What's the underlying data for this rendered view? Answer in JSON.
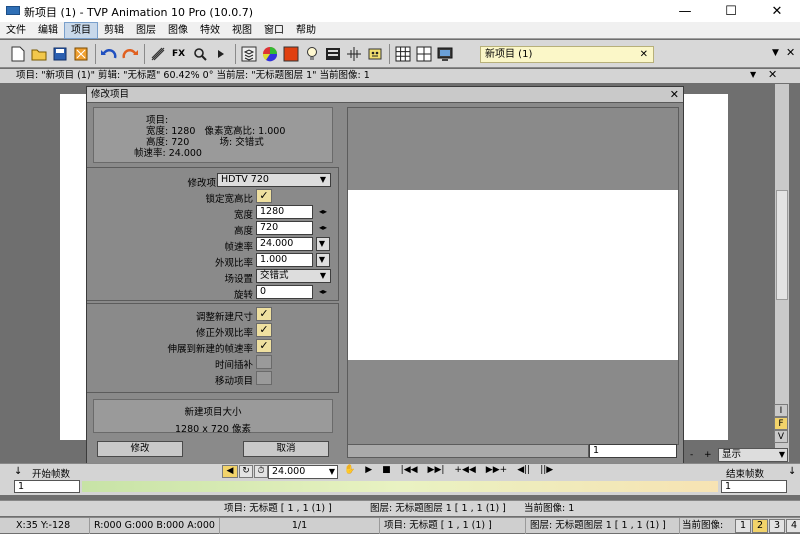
{
  "window": {
    "title": "新项目 (1) - TVP Animation 10 Pro (10.0.7)",
    "minimize": "—",
    "maximize": "☐",
    "close": "✕"
  },
  "menu": [
    "文件",
    "编辑",
    "项目",
    "剪辑",
    "图层",
    "图像",
    "特效",
    "视图",
    "窗口",
    "帮助"
  ],
  "menu_active": "项目",
  "toolbar": {
    "icons": [
      "new-file-icon",
      "open-folder-icon",
      "save-icon",
      "export-icon",
      "undo-icon",
      "redo-icon",
      "brush-tools-icon",
      "fx-icon",
      "zoom-icon",
      "play-icon",
      "layers-icon",
      "color-wheel-icon",
      "color-swatch-icon",
      "light-bulb-icon",
      "display-icon",
      "crosshair-icon",
      "robot-icon",
      "grid-icon",
      "panels-icon",
      "monitor-icon"
    ],
    "fx_label": "FX",
    "project_tab": "新项目 (1)",
    "project_tab_close": "✕"
  },
  "infobar": "项目: \"新项目 (1)\" 剪辑: \"无标题\" 60.42% 0° 当前层: \"无标题图层 1\" 当前图像: 1",
  "dialog": {
    "title": "修改项目",
    "close": "✕",
    "info": {
      "project_label": "项目:",
      "width_line": "宽度: 1280   像素宽高比: 1.000",
      "height_line": "高度: 720          场: 交错式",
      "fps_line": "帧速率: 24.000"
    },
    "modify_to_label": "修改项目到",
    "modify_to_value": "HDTV 720",
    "lock_ratio_label": "锁定宽高比",
    "width_label": "宽度",
    "width_value": "1280",
    "height_label": "高度",
    "height_value": "720",
    "fps_label": "帧速率",
    "fps_value": "24.000",
    "aspect_label": "外观比率",
    "aspect_value": "1.000",
    "field_label": "场设置",
    "field_value": "交错式",
    "rotate_label": "旋转",
    "rotate_value": "0",
    "options": [
      {
        "label": "调整新建尺寸",
        "checked": true
      },
      {
        "label": "修正外观比率",
        "checked": true
      },
      {
        "label": "伸展到新建的帧速率",
        "checked": true
      },
      {
        "label": "时间插补",
        "checked": false
      },
      {
        "label": "移动项目",
        "checked": false
      }
    ],
    "newsize_title": "新建项目大小",
    "newsize_value": "1280 x 720 像素",
    "modify_button": "修改",
    "cancel_button": "取消",
    "preview_field": "1"
  },
  "side_buttons": [
    "I",
    "F",
    "V"
  ],
  "display_label": "显示",
  "timeline": {
    "start_label": "开始帧数",
    "fps_value": "24.000",
    "end_label": "结束帧数",
    "start_value": "1",
    "end_value": "1"
  },
  "status1": {
    "project": "项目: 无标题 [ 1 , 1 (1) ]",
    "layer": "图层: 无标题图层 1 [ 1 , 1 (1) ]",
    "image": "当前图像: 1"
  },
  "status2": {
    "coords": "X:35  Y:-128",
    "rgba": "R:000 G:000 B:000 A:000",
    "page": "1/1",
    "project": "项目: 无标题 [ 1 , 1 (1) ]",
    "layer": "图层: 无标题图层 1 [ 1 , 1 (1) ]",
    "image": "当前图像:",
    "pages": [
      "1",
      "2",
      "3",
      "4"
    ],
    "active_page": "2"
  }
}
